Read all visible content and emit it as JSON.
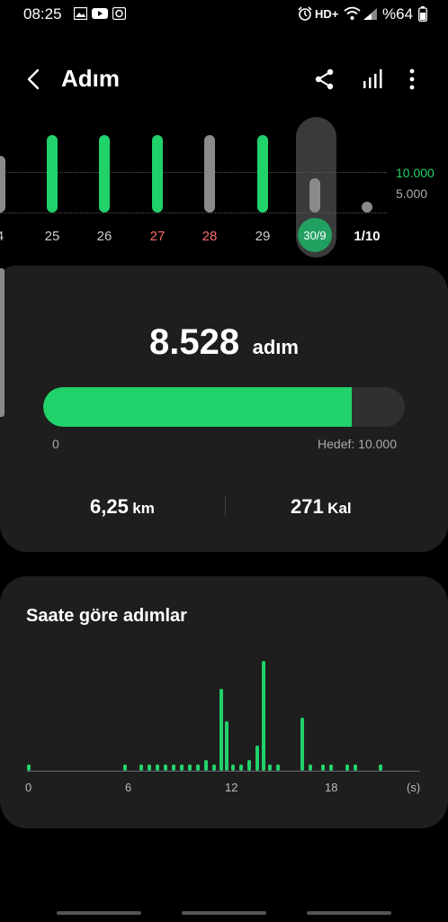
{
  "status_bar": {
    "time": "08:25",
    "network": "HD+",
    "battery": "%64"
  },
  "header": {
    "title": "Adım"
  },
  "weekly_chart": {
    "days": [
      {
        "label": "4",
        "value": 3500,
        "color": "#8a8a8a"
      },
      {
        "label": "25",
        "value": 12500,
        "color": "#21d26b"
      },
      {
        "label": "26",
        "value": 12000,
        "color": "#21d26b"
      },
      {
        "label": "27",
        "value": 8000,
        "color": "#21d26b",
        "label_color": "#ff6b6b"
      },
      {
        "label": "28",
        "value": 6500,
        "color": "#8a8a8a",
        "label_color": "#ff6b6b"
      },
      {
        "label": "29",
        "value": 14000,
        "color": "#21d26b"
      },
      {
        "label": "30/9",
        "value": 8528,
        "color": "#8a8a8a",
        "selected": true
      },
      {
        "label": "1/10",
        "value": 0,
        "color": "#8a8a8a",
        "bold": true
      }
    ],
    "goal_labels": [
      "10.000",
      "5.000"
    ],
    "goal_colors": [
      "#21d26b",
      "#aaaaaa"
    ]
  },
  "summary": {
    "steps": "8.528",
    "steps_unit": "adım",
    "progress_fraction": 0.8528,
    "min_label": "0",
    "target_label": "Hedef: 10.000",
    "distance_value": "6,25",
    "distance_unit": "km",
    "calories_value": "271",
    "calories_unit": "Kal"
  },
  "hourly": {
    "title": "Saate göre adımlar",
    "x_ticks": [
      "0",
      "6",
      "12",
      "18",
      "(s)"
    ],
    "accent": "#21d26b"
  },
  "chart_data": {
    "type": "bar",
    "title": "Saate göre adımlar",
    "xlabel": "(s)",
    "x": [
      0,
      6,
      7,
      7.5,
      8,
      8.5,
      9,
      9.5,
      10,
      10.5,
      11,
      11.5,
      12,
      12.3,
      12.7,
      13.2,
      13.7,
      14.2,
      14.6,
      15,
      15.5,
      17,
      17.5,
      18.3,
      18.8,
      19.8,
      20.3,
      21.9
    ],
    "values": [
      60,
      60,
      60,
      60,
      60,
      60,
      60,
      60,
      60,
      60,
      100,
      60,
      750,
      450,
      60,
      60,
      100,
      230,
      1000,
      60,
      60,
      480,
      60,
      60,
      60,
      60,
      60,
      60
    ],
    "xlim": [
      0,
      23
    ]
  }
}
